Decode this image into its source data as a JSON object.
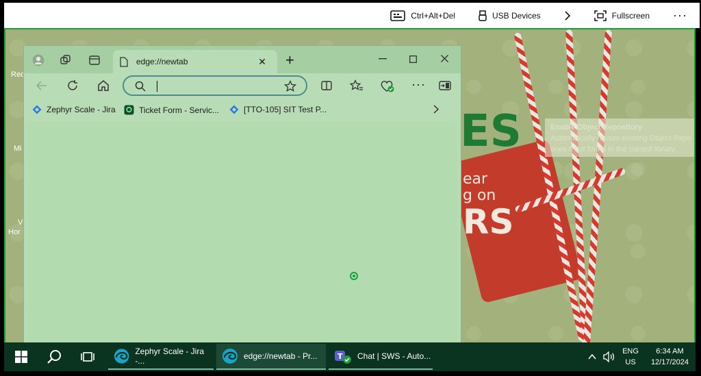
{
  "remote_bar": {
    "ctrl_alt_del": "Ctrl+Alt+Del",
    "usb_devices": "USB Devices",
    "fullscreen": "Fullscreen",
    "more": "···"
  },
  "wallpaper": {
    "tooltip_title": "Enable Object Repository",
    "tooltip_line1": "Automatically reuses existing Object Repo",
    "tooltip_line2": "ones if not found in the current library.",
    "tag_text1": "ear",
    "tag_text2": "g on",
    "tag_text3": "RS",
    "green_text": "ES"
  },
  "desktop_icons": [
    "Rec",
    "Mi",
    "Vi",
    "Hor"
  ],
  "edge": {
    "tab_title": "edge://newtab",
    "address_value": "",
    "favorites": [
      {
        "label": "Zephyr Scale - Jira"
      },
      {
        "label": "Ticket Form - Servic..."
      },
      {
        "label": "[TTO-105] SIT Test P..."
      }
    ]
  },
  "taskbar": {
    "apps": [
      {
        "label": "Zephyr Scale - Jira -..."
      },
      {
        "label": "edge://newtab - Pr..."
      },
      {
        "label": "Chat | SWS - Auto..."
      }
    ],
    "lang_top": "ENG",
    "lang_bottom": "US",
    "time": "6:34 AM",
    "date": "12/17/2024"
  },
  "colors": {
    "accent_green": "#17a336",
    "taskbar": "#0a3320",
    "edge_tint": "#b6dcb4"
  }
}
